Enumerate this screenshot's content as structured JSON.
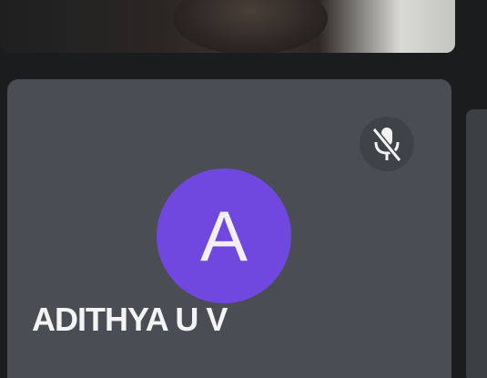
{
  "top_video": {
    "kind": "camera-feed"
  },
  "participant": {
    "initial": "A",
    "name": "ADITHYA U V",
    "avatar_color": "#7048e0",
    "mic_status": "muted",
    "mic_icon": "mic-off-icon"
  },
  "colors": {
    "background": "#1b1c1e",
    "tile": "#4a4d53",
    "text": "#f4f4f4"
  }
}
